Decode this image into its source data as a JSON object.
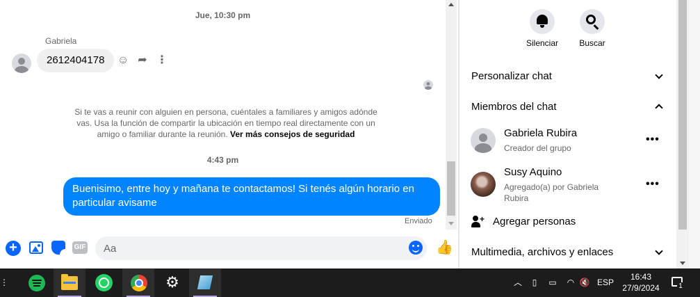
{
  "chat": {
    "timestamp_1": "Jue, 10:30 pm",
    "sender_name": "Gabriela",
    "received_message": "2612404178",
    "safety_notice": "Si te vas a reunir con alguien en persona, cuéntales a familiares y amigos adónde vas. Usa la función de compartir la ubicación en tiempo real directamente con un amigo o familiar durante la reunión.",
    "safety_link": "Ver más consejos de seguridad",
    "timestamp_2": "4:43 pm",
    "sent_message": "Buenisimo, entre hoy y mañana te contactamos! Si tenés algún horario en particular avisame",
    "sent_status": "Enviado"
  },
  "composer": {
    "placeholder": "Aa",
    "gif_label": "GIF"
  },
  "panel": {
    "mute_label": "Silenciar",
    "search_label": "Buscar",
    "customize_chat": "Personalizar chat",
    "chat_members": "Miembros del chat",
    "members": [
      {
        "name": "Gabriela Rubira",
        "subtitle": "Creador del grupo"
      },
      {
        "name": "Susy Aquino",
        "subtitle": "Agregado(a) por Gabriela Rubira"
      }
    ],
    "add_people": "Agregar personas",
    "media_files_links": "Multimedia, archivos y enlaces"
  },
  "taskbar": {
    "apps": [
      "spotify-icon",
      "file-explorer-icon",
      "whatsapp-icon",
      "chrome-icon",
      "settings-icon",
      "notes-icon"
    ],
    "language": "ESP",
    "time": "16:43",
    "date": "27/9/2024",
    "notification_count": "1"
  }
}
